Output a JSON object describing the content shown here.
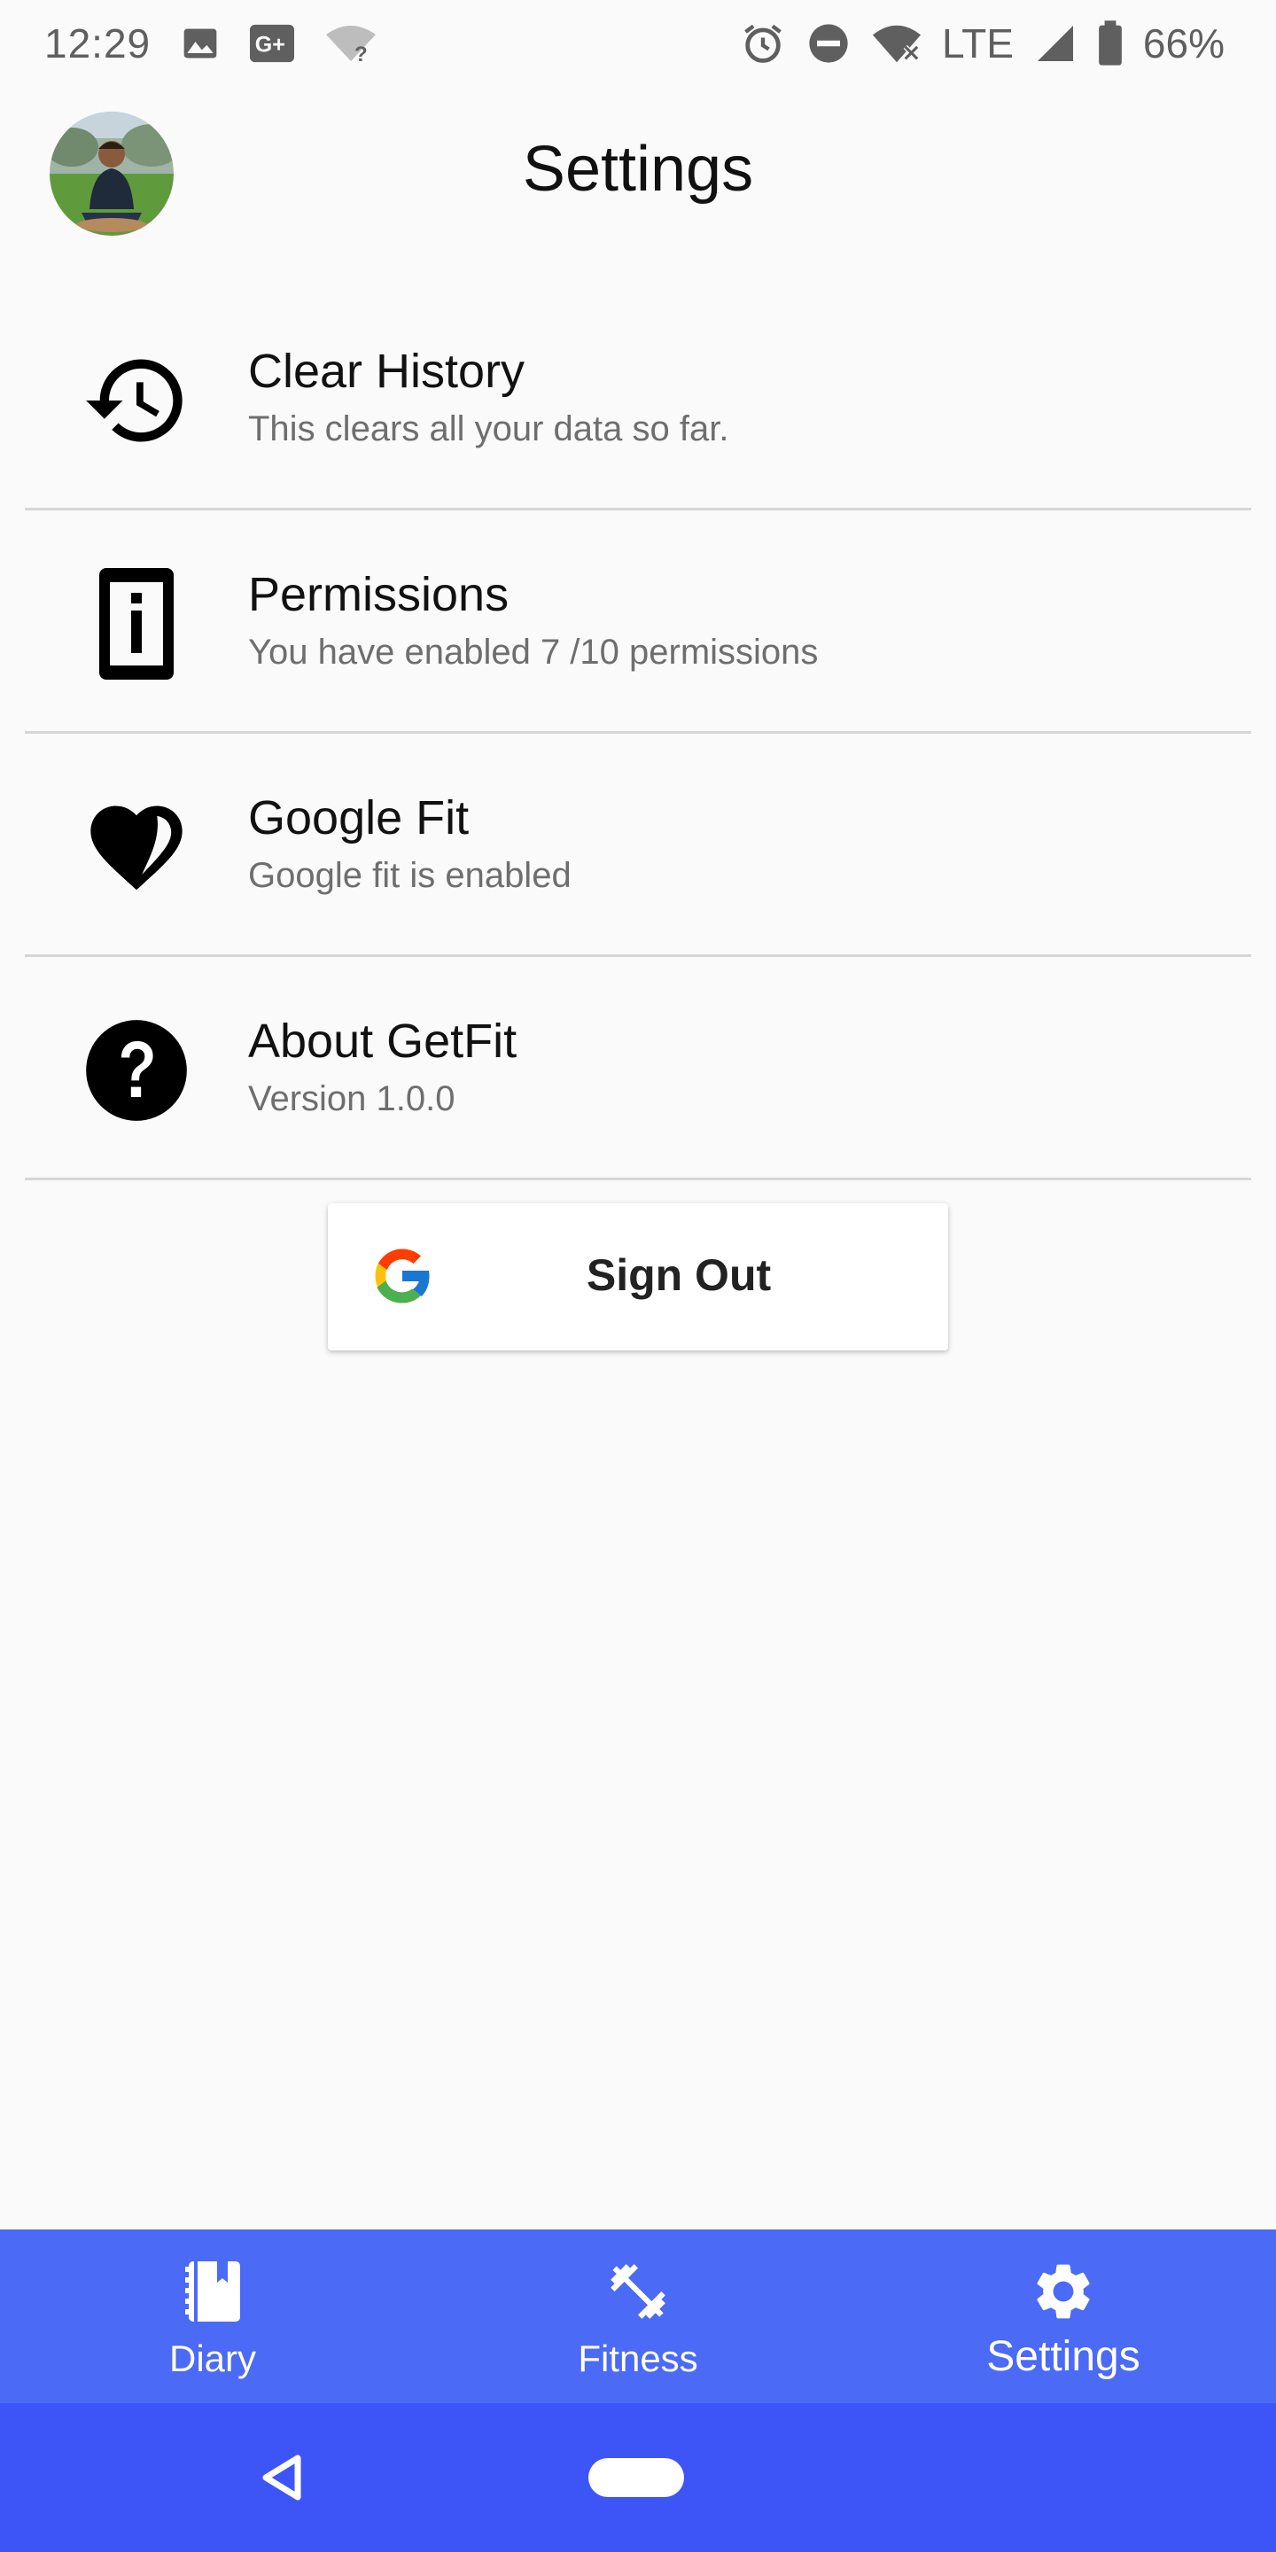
{
  "status_bar": {
    "time": "12:29",
    "network": "LTE",
    "battery": "66%",
    "icons": [
      "image-icon",
      "google-plus-icon",
      "wifi-question-icon",
      "alarm-icon",
      "do-not-disturb-icon",
      "wifi-off-icon",
      "signal-icon",
      "battery-icon"
    ]
  },
  "header": {
    "title": "Settings"
  },
  "settings": {
    "items": [
      {
        "title": "Clear History",
        "subtitle": "This clears all your data so far.",
        "icon": "history-icon"
      },
      {
        "title": "Permissions",
        "subtitle": "You have enabled 7 /10 permissions",
        "icon": "phone-info-icon"
      },
      {
        "title": "Google Fit",
        "subtitle": "Google fit is enabled",
        "icon": "heart-icon"
      },
      {
        "title": "About GetFit",
        "subtitle": "Version 1.0.0",
        "icon": "help-icon"
      }
    ]
  },
  "sign_out": {
    "label": "Sign Out",
    "icon": "google-logo-icon"
  },
  "bottom_nav": {
    "items": [
      {
        "label": "Diary",
        "icon": "diary-icon",
        "active": false
      },
      {
        "label": "Fitness",
        "icon": "dumbbell-icon",
        "active": false
      },
      {
        "label": "Settings",
        "icon": "gear-icon",
        "active": true
      }
    ]
  },
  "colors": {
    "background": "#fafafa",
    "bottom_nav": "#4b6af5",
    "system_nav": "#3d55f7",
    "divider": "#d6d6d6",
    "subtitle": "#6e6e6e"
  }
}
